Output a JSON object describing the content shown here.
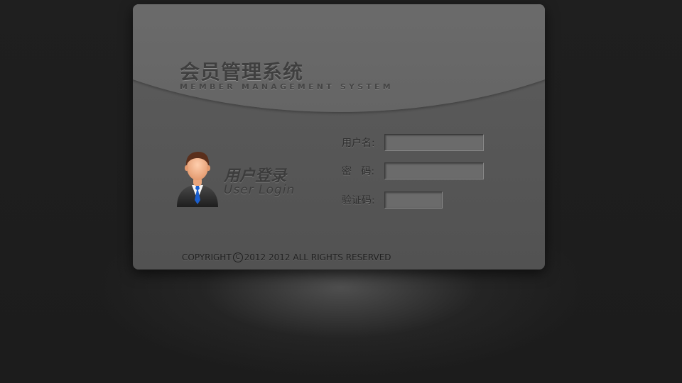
{
  "header": {
    "title_cn": "会员管理系统",
    "title_en": "MEMBER MANAGEMENT SYSTEM"
  },
  "login": {
    "heading_cn": "用户登录",
    "heading_en": "User Login",
    "avatar_icon": "user-avatar-icon"
  },
  "form": {
    "username_label": "用户名:",
    "username_value": "",
    "password_label": "密   码:",
    "password_value": "",
    "captcha_label": "验证码:",
    "captcha_value": ""
  },
  "footer": {
    "copyright_prefix": "COPYRIGHT",
    "copyright_symbol": "C",
    "copyright_suffix": "2012 2012 ALL RIGHTS RESERVED"
  },
  "colors": {
    "background": "#1e1e1e",
    "panel": "#585858",
    "header_arc": "#727272",
    "input_bg": "#6b6b6b",
    "tie": "#1a5fd0"
  }
}
